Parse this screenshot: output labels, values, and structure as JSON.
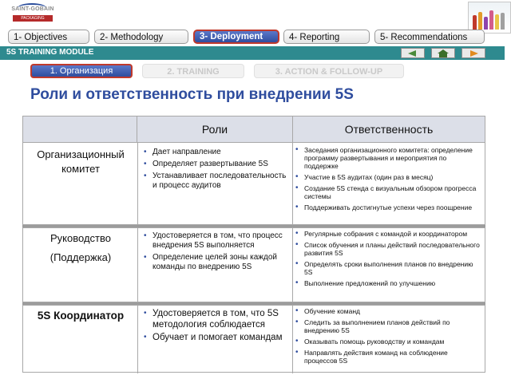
{
  "logo": {
    "brand": "SAINT-GOBAIN",
    "sub": "PACKAGING"
  },
  "nav_tabs": [
    {
      "label": "1- Objectives",
      "active": false
    },
    {
      "label": "2- Methodology",
      "active": false
    },
    {
      "label": "3- Deployment",
      "active": true
    },
    {
      "label": "4- Reporting",
      "active": false
    },
    {
      "label": "5- Recommendations",
      "active": false
    }
  ],
  "banner": {
    "title": "5S TRAINING MODULE"
  },
  "sub_tabs": [
    {
      "label": "1. Организация",
      "active": true
    },
    {
      "label": "2. TRAINING",
      "active": false
    },
    {
      "label": "3. ACTION & FOLLOW-UP",
      "active": false
    }
  ],
  "page_title": "Роли и ответственность при внедрении 5S",
  "table": {
    "headers": [
      "",
      "Роли",
      "Ответственность"
    ],
    "rows": [
      {
        "label": "Организационный комитет",
        "roles": [
          "Дает направление",
          "Определяет развертывание 5S",
          "Устанавливает последовательность и процесс аудитов"
        ],
        "responsibilities": [
          "Заседания организационного комитета: определение программу развертывания и мероприятия по поддержке",
          "Участие в 5S аудитах (один раз в месяц)",
          "Создание 5S стенда с визуальным обзором прогресса системы",
          "Поддерживать достигнутые успехи через поощрение"
        ]
      },
      {
        "label_line1": "Руководство",
        "label_line2": "(Поддержка)",
        "roles": [
          "Удостоверяется в том, что процесс внедрения 5S выполняется",
          "Определение целей зоны каждой команды по внедрению 5S"
        ],
        "responsibilities": [
          "Регулярные собрания с командой и координатором",
          "Список обучения и планы действий последовательного развития 5S",
          "Определять сроки выполнения планов по внедрению 5S",
          "Выполнение предложений по улучшению"
        ]
      },
      {
        "label": "5S Координатор",
        "roles": [
          "Удостоверяется в том, что 5S методология соблюдается",
          "Обучает и помогает командам"
        ],
        "responsibilities": [
          "Обучение команд",
          "Следить за выполнением планов действий по внедрению 5S",
          "Оказывать помощь руководству и командам",
          "Направлять действия команд на соблюдение процессов 5S"
        ]
      }
    ]
  },
  "colors": {
    "accent": "#2f4d9e",
    "banner": "#2e8a8f",
    "active_border": "#c0392b"
  },
  "icons": [
    "arrow-left-icon",
    "home-icon",
    "arrow-right-icon"
  ]
}
